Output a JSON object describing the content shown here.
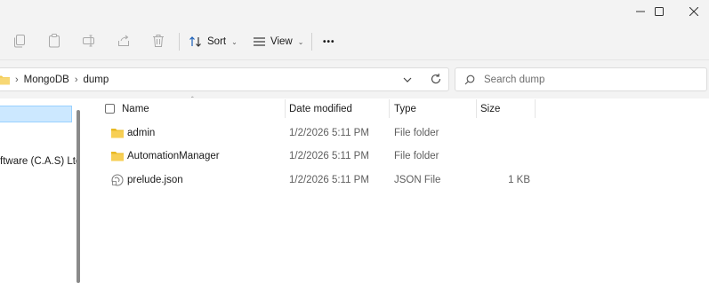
{
  "window": {
    "minimize_icon": "minimize-icon",
    "maximize_icon": "maximize-icon",
    "close_icon": "close-icon"
  },
  "toolbar": {
    "sort_label": "Sort",
    "view_label": "View",
    "more_label": "•••"
  },
  "address": {
    "crumbs": [
      "MongoDB",
      "dump"
    ]
  },
  "search": {
    "placeholder": "Search dump"
  },
  "nav": {
    "item_label": "ftware (C.A.S) Ltd"
  },
  "columns": {
    "name": "Name",
    "date": "Date modified",
    "type": "Type",
    "size": "Size"
  },
  "files": [
    {
      "name": "admin",
      "date": "1/2/2026 5:11 PM",
      "type": "File folder",
      "size": "",
      "icon": "folder-icon"
    },
    {
      "name": "AutomationManager",
      "date": "1/2/2026 5:11 PM",
      "type": "File folder",
      "size": "",
      "icon": "folder-icon"
    },
    {
      "name": "prelude.json",
      "date": "1/2/2026 5:11 PM",
      "type": "JSON File",
      "size": "1 KB",
      "icon": "json-file-icon"
    }
  ],
  "colors": {
    "chrome": "#f3f3f3",
    "selection": "#cce8ff",
    "folder": "#f2c94c"
  }
}
